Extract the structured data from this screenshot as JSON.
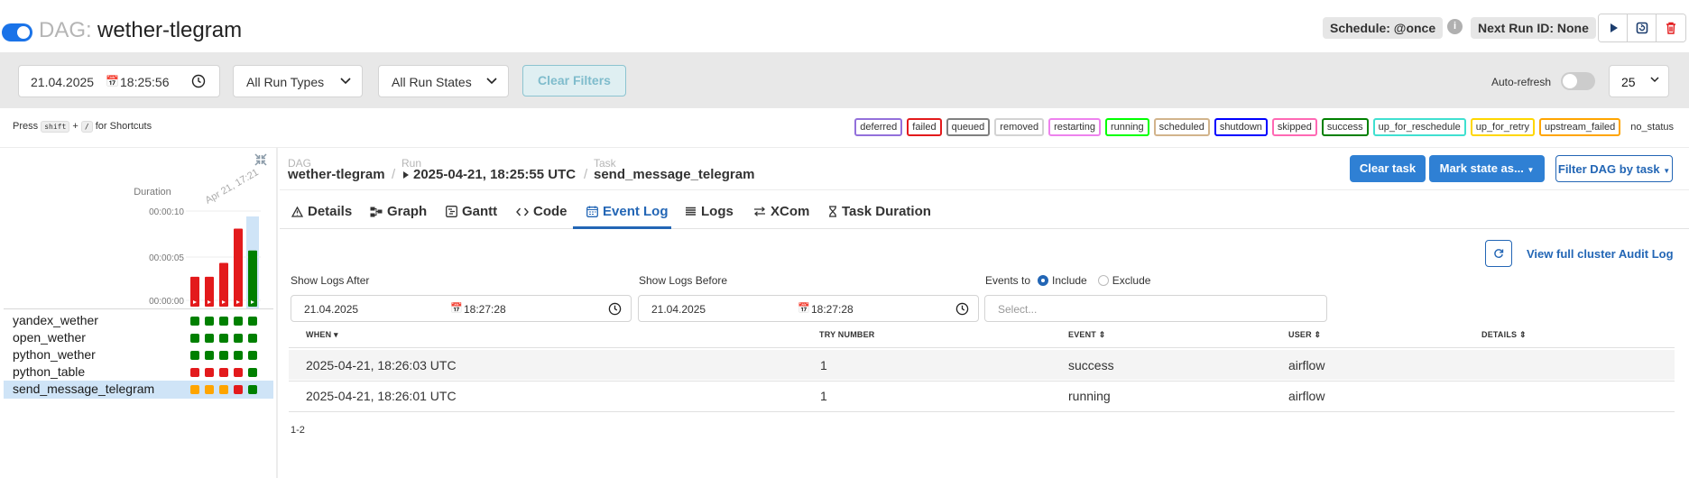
{
  "header": {
    "dag_prefix": "DAG:",
    "dag_name": "wether-tlegram",
    "schedule": "Schedule: @once",
    "next_run": "Next Run ID: None",
    "info": "i"
  },
  "filters": {
    "date": "21.04.2025",
    "time": "18:25:56",
    "run_types": "All Run Types",
    "run_states": "All Run States",
    "clear_filters": "Clear Filters",
    "auto_refresh": "Auto-refresh",
    "page_size": "25"
  },
  "shortcuts": {
    "press": "Press",
    "key1": "shift",
    "plus": "+",
    "key2": "/",
    "suffix": "for Shortcuts"
  },
  "legend": [
    {
      "label": "deferred",
      "color": "#9370db"
    },
    {
      "label": "failed",
      "color": "#e31a1c"
    },
    {
      "label": "queued",
      "color": "#808080"
    },
    {
      "label": "removed",
      "color": "#d3d3d3"
    },
    {
      "label": "restarting",
      "color": "#ee82ee"
    },
    {
      "label": "running",
      "color": "#00ff00"
    },
    {
      "label": "scheduled",
      "color": "#d2b48c"
    },
    {
      "label": "shutdown",
      "color": "#0000ff"
    },
    {
      "label": "skipped",
      "color": "#ff69b4"
    },
    {
      "label": "success",
      "color": "#008000"
    },
    {
      "label": "up_for_reschedule",
      "color": "#40e0d0"
    },
    {
      "label": "up_for_retry",
      "color": "#ffd700"
    },
    {
      "label": "upstream_failed",
      "color": "#ffa500"
    }
  ],
  "legend_nostatus": "no_status",
  "grid": {
    "duration_label": "Duration",
    "run_date_label": "Apr 21, 17:21",
    "y_ticks": [
      "00:00:10",
      "00:00:05",
      "00:00:00"
    ],
    "run_durations": [
      {
        "seconds": 4.1,
        "state": "failed"
      },
      {
        "seconds": 4.1,
        "state": "failed"
      },
      {
        "seconds": 6.0,
        "state": "failed"
      },
      {
        "seconds": 10.7,
        "state": "failed"
      },
      {
        "seconds": 7.7,
        "state": "success",
        "selected": true
      }
    ],
    "tasks": [
      {
        "name": "yandex_wether",
        "states": [
          "success",
          "success",
          "success",
          "success",
          "success"
        ]
      },
      {
        "name": "open_wether",
        "states": [
          "success",
          "success",
          "success",
          "success",
          "success"
        ]
      },
      {
        "name": "python_wether",
        "states": [
          "success",
          "success",
          "success",
          "success",
          "success"
        ]
      },
      {
        "name": "python_table",
        "states": [
          "failed",
          "failed",
          "failed",
          "failed",
          "success"
        ]
      },
      {
        "name": "send_message_telegram",
        "states": [
          "upstream_failed",
          "upstream_failed",
          "upstream_failed",
          "failed",
          "success"
        ],
        "selected": true
      }
    ]
  },
  "colors": {
    "success": "#008000",
    "failed": "#e31a1c",
    "upstream_failed": "#ffa500",
    "accent": "#2366b5",
    "selected": "#cfe4f7"
  },
  "breadcrumb": {
    "dag_label": "DAG",
    "dag_value": "wether-tlegram",
    "run_label": "Run",
    "run_value": "2025-04-21, 18:25:55 UTC",
    "task_label": "Task",
    "task_value": "send_message_telegram"
  },
  "actions": {
    "clear_task": "Clear task",
    "mark_state": "Mark state as...",
    "filter_dag": "Filter DAG by task"
  },
  "tabs": [
    "Details",
    "Graph",
    "Gantt",
    "Code",
    "Event Log",
    "Logs",
    "XCom",
    "Task Duration"
  ],
  "active_tab": "Event Log",
  "event_log": {
    "audit_link": "View full cluster Audit Log",
    "show_after_label": "Show Logs After",
    "after_date": "21.04.2025",
    "after_time": "18:27:28",
    "show_before_label": "Show Logs Before",
    "before_date": "21.04.2025",
    "before_time": "18:27:28",
    "events_to": "Events to",
    "include": "Include",
    "exclude": "Exclude",
    "select_placeholder": "Select...",
    "columns": [
      "WHEN",
      "TRY NUMBER",
      "EVENT",
      "USER",
      "DETAILS"
    ],
    "rows": [
      {
        "when": "2025-04-21, 18:26:03 UTC",
        "try": "1",
        "event": "success",
        "user": "airflow",
        "details": ""
      },
      {
        "when": "2025-04-21, 18:26:01 UTC",
        "try": "1",
        "event": "running",
        "user": "airflow",
        "details": ""
      }
    ],
    "pagination": "1-2"
  }
}
